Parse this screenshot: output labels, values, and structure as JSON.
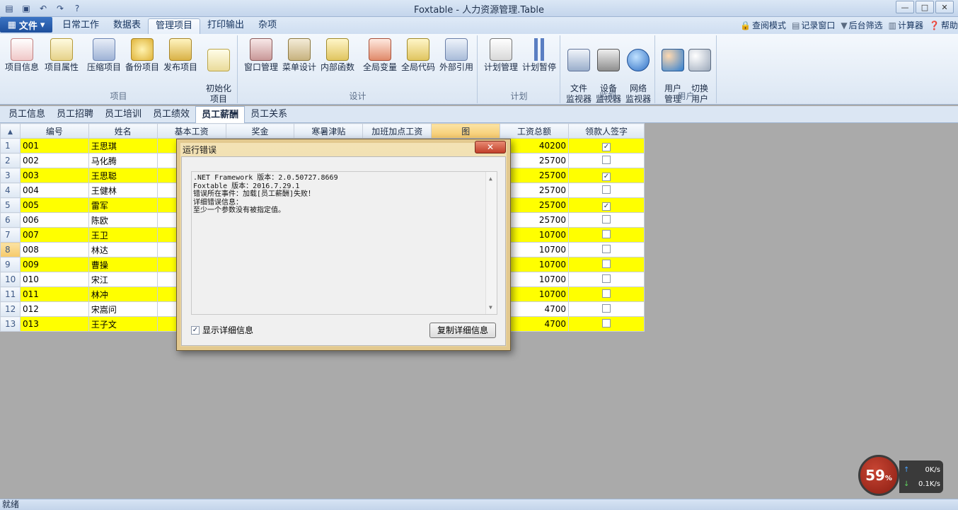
{
  "window": {
    "title": "Foxtable - 人力资源管理.Table",
    "controls": {
      "minimize": "—",
      "maximize": "□",
      "close": "✕"
    }
  },
  "ribbon": {
    "file_label": "文件",
    "tabs": [
      "日常工作",
      "数据表",
      "管理项目",
      "打印输出",
      "杂项"
    ],
    "active_tab": "管理项目",
    "right_commands": [
      {
        "icon": "lock-icon",
        "label": "查阅模式"
      },
      {
        "icon": "window-icon",
        "label": "记录窗口"
      },
      {
        "icon": "filter-icon",
        "label": "后台筛选"
      },
      {
        "icon": "calculator-icon",
        "label": "计算器"
      },
      {
        "icon": "help-icon",
        "label": "帮助"
      }
    ],
    "groups": {
      "project": {
        "title": "项目",
        "buttons": [
          "项目信息",
          "项目属性",
          "压缩项目",
          "备份项目",
          "发布项目",
          "初始化\n项目"
        ]
      },
      "design": {
        "title": "设计",
        "buttons": [
          "窗口管理",
          "菜单设计",
          "内部函数",
          "全局变量",
          "全局代码",
          "外部引用"
        ]
      },
      "plan": {
        "title": "计划",
        "buttons": [
          "计划管理",
          "计划暂停"
        ]
      },
      "monitor": {
        "title": "监视",
        "buttons": [
          "文件\n监视器",
          "设备\n监视器",
          "网络\n监视器"
        ]
      },
      "user": {
        "title": "用户",
        "buttons": [
          "用户\n管理",
          "切换\n用户"
        ]
      }
    }
  },
  "sheet_tabs": [
    "员工信息",
    "员工招聘",
    "员工培训",
    "员工绩效",
    "员工薪酬",
    "员工关系"
  ],
  "active_sheet": "员工薪酬",
  "table": {
    "columns": [
      "编号",
      "姓名",
      "基本工资",
      "奖金",
      "寒暑津贴",
      "加班加点工资",
      "图",
      "工资总额",
      "领款人签字"
    ],
    "rows": [
      {
        "n": "1",
        "code": "001",
        "name": "王思琪",
        "total": "40200",
        "signed": true
      },
      {
        "n": "2",
        "code": "002",
        "name": "马化腾",
        "total": "25700",
        "signed": false
      },
      {
        "n": "3",
        "code": "003",
        "name": "王思聪",
        "total": "25700",
        "signed": true
      },
      {
        "n": "4",
        "code": "004",
        "name": "王健林",
        "total": "25700",
        "signed": false
      },
      {
        "n": "5",
        "code": "005",
        "name": "雷军",
        "total": "25700",
        "signed": true
      },
      {
        "n": "6",
        "code": "006",
        "name": "陈欧",
        "total": "25700",
        "signed": false
      },
      {
        "n": "7",
        "code": "007",
        "name": "王卫",
        "total": "10700",
        "signed": false
      },
      {
        "n": "8",
        "code": "008",
        "name": "林达",
        "total": "10700",
        "signed": false
      },
      {
        "n": "9",
        "code": "009",
        "name": "曹操",
        "total": "10700",
        "signed": false
      },
      {
        "n": "10",
        "code": "010",
        "name": "宋江",
        "total": "10700",
        "signed": false
      },
      {
        "n": "11",
        "code": "011",
        "name": "林冲",
        "total": "10700",
        "signed": false
      },
      {
        "n": "12",
        "code": "012",
        "name": "宋嵩问",
        "total": "4700",
        "signed": false
      },
      {
        "n": "13",
        "code": "013",
        "name": "王子文",
        "total": "4700",
        "signed": false
      }
    ]
  },
  "dialog": {
    "title": "运行错误",
    "close_label": "✕",
    "lines": [
      ".NET Framework 版本：2.0.50727.8669",
      "Foxtable 版本：2016.7.29.1",
      "错误所在事件：加载[员工薪酬]失败！",
      "详细错误信息：",
      "至少一个参数没有被指定值。"
    ],
    "show_details_label": "显示详细信息",
    "copy_button_label": "复制详细信息"
  },
  "statusbar": {
    "text": "就绪"
  },
  "speed_widget": {
    "percent": "59",
    "percent_sign": "%",
    "up": "0",
    "up_unit": "K/s",
    "down": "0.1",
    "down_unit": "K/s"
  }
}
